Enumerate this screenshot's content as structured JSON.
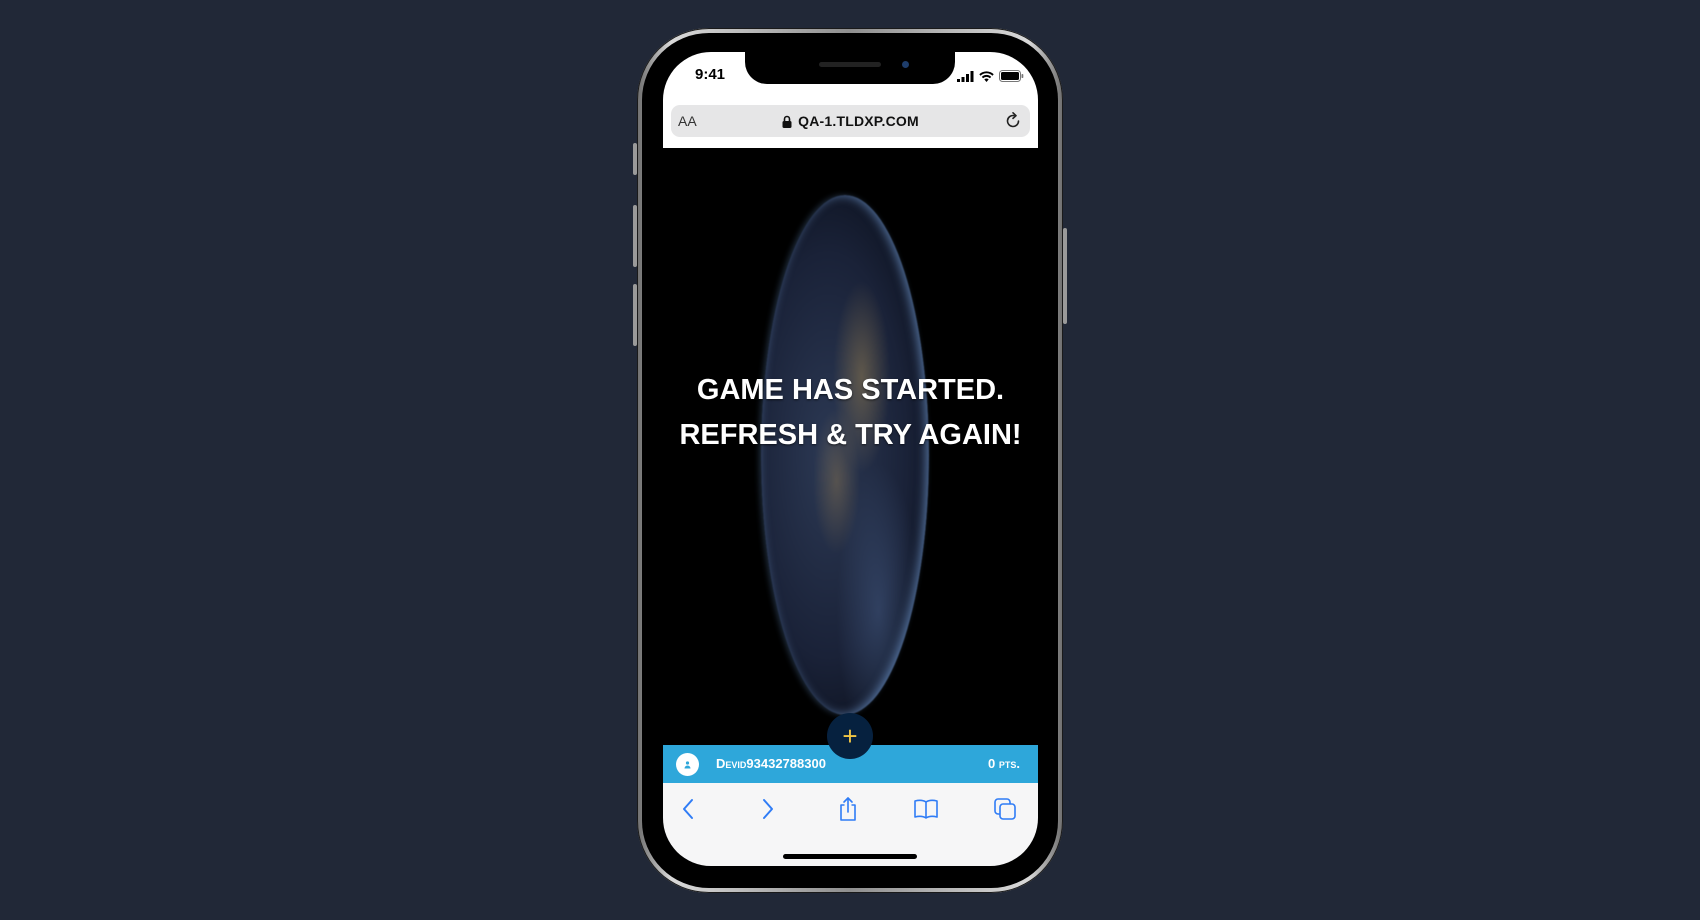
{
  "status_bar": {
    "time": "9:41",
    "icons": [
      "signal-icon",
      "wifi-icon",
      "battery-icon"
    ]
  },
  "browser": {
    "text_size_label": "AA",
    "url": "QA-1.TLDXP.COM",
    "icons": [
      "lock-icon",
      "reload-icon"
    ]
  },
  "game": {
    "message": "GAME HAS STARTED. REFRESH & TRY AGAIN!",
    "add_button_label": "+",
    "player": {
      "name": "Devid93432788300",
      "points": "0 pts."
    }
  },
  "toolbar": {
    "items": [
      "back-icon",
      "forward-icon",
      "share-icon",
      "bookmarks-icon",
      "tabs-icon"
    ],
    "accent_color": "#2f7cf6"
  },
  "colors": {
    "page_background": "#212837",
    "player_bar": "#2ea7da",
    "add_button": "#06213f",
    "add_button_icon": "#f2c744"
  }
}
